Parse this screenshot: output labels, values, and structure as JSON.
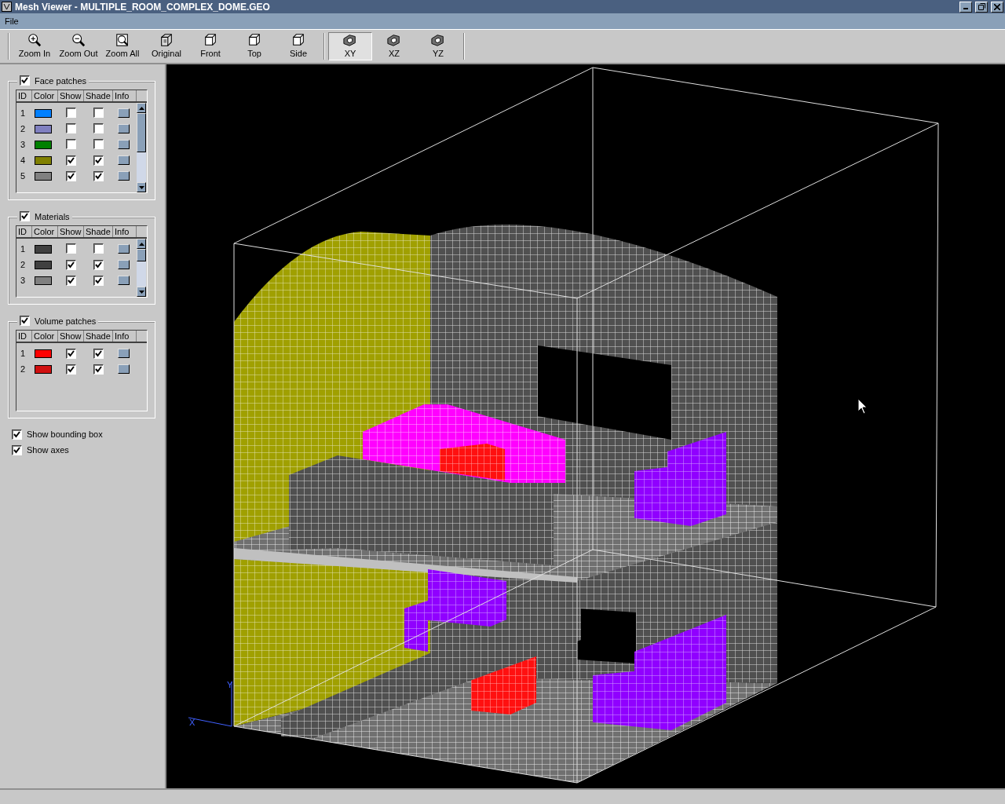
{
  "window": {
    "title": "Mesh Viewer - MULTIPLE_ROOM_COMPLEX_DOME.GEO"
  },
  "menu": [
    "File"
  ],
  "toolbar": [
    {
      "label": "Zoom In",
      "kind": "zoom-in",
      "selected": false
    },
    {
      "label": "Zoom Out",
      "kind": "zoom-out",
      "selected": false
    },
    {
      "label": "Zoom All",
      "kind": "zoom-all",
      "selected": false
    },
    {
      "label": "Original",
      "kind": "original",
      "selected": false
    },
    {
      "label": "Front",
      "kind": "cube",
      "selected": false
    },
    {
      "label": "Top",
      "kind": "cube",
      "selected": false
    },
    {
      "label": "Side",
      "kind": "cube",
      "selected": false
    },
    {
      "label": "XY",
      "kind": "plane",
      "selected": true
    },
    {
      "label": "XZ",
      "kind": "plane",
      "selected": false
    },
    {
      "label": "YZ",
      "kind": "plane",
      "selected": false
    }
  ],
  "groups": [
    {
      "title": "Face patches",
      "checked": true,
      "columns": [
        "ID",
        "Color",
        "Show",
        "Shade",
        "Info"
      ],
      "scrollbar": true,
      "rows": [
        {
          "id": "1",
          "color": "#0080ff",
          "show": false,
          "shade": false
        },
        {
          "id": "2",
          "color": "#8080c0",
          "show": false,
          "shade": false
        },
        {
          "id": "3",
          "color": "#008000",
          "show": false,
          "shade": false
        },
        {
          "id": "4",
          "color": "#808000",
          "show": true,
          "shade": true
        },
        {
          "id": "5",
          "color": "#808080",
          "show": true,
          "shade": true
        }
      ]
    },
    {
      "title": "Materials",
      "checked": true,
      "columns": [
        "ID",
        "Color",
        "Show",
        "Shade",
        "Info"
      ],
      "scrollbar": true,
      "rows": [
        {
          "id": "1",
          "color": "#404040",
          "show": false,
          "shade": false
        },
        {
          "id": "2",
          "color": "#404040",
          "show": true,
          "shade": true
        },
        {
          "id": "3",
          "color": "#808080",
          "show": true,
          "shade": true
        }
      ]
    },
    {
      "title": "Volume patches",
      "checked": true,
      "columns": [
        "ID",
        "Color",
        "Show",
        "Shade",
        "Info"
      ],
      "scrollbar": false,
      "rows": [
        {
          "id": "1",
          "color": "#ff0000",
          "show": true,
          "shade": true
        },
        {
          "id": "2",
          "color": "#d01010",
          "show": true,
          "shade": true
        }
      ]
    }
  ],
  "options": [
    {
      "label": "Show bounding box",
      "checked": true
    },
    {
      "label": "Show axes",
      "checked": true
    }
  ],
  "viewport": {
    "axis_labels": [
      "Y",
      "X"
    ]
  }
}
